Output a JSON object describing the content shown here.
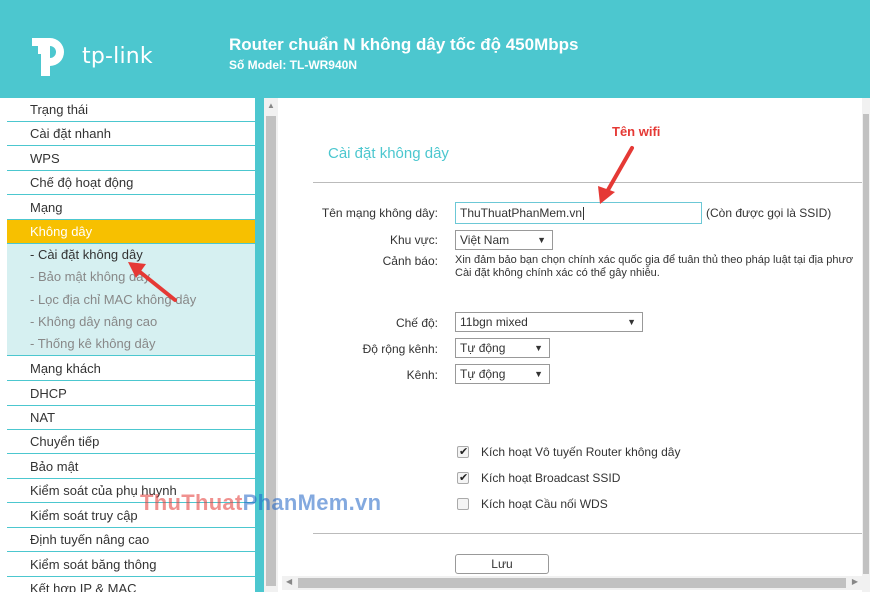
{
  "header": {
    "logo_text": "tp-link",
    "title": "Router chuẩn N không dây tốc độ 450Mbps",
    "model": "Số Model: TL-WR940N",
    "bg_color": "#4cc7cf"
  },
  "sidebar": {
    "items": [
      {
        "label": "Trạng thái"
      },
      {
        "label": "Cài đặt nhanh"
      },
      {
        "label": "WPS"
      },
      {
        "label": "Chế độ hoạt động"
      },
      {
        "label": "Mạng"
      },
      {
        "label": "Không dây"
      },
      {
        "label": "Mạng khách"
      },
      {
        "label": "DHCP"
      },
      {
        "label": "NAT"
      },
      {
        "label": "Chuyển tiếp"
      },
      {
        "label": "Bảo mật"
      },
      {
        "label": "Kiểm soát của phụ huynh"
      },
      {
        "label": "Kiểm soát truy cập"
      },
      {
        "label": "Định tuyến nâng cao"
      },
      {
        "label": "Kiểm soát băng thông"
      },
      {
        "label": "Kết hợp IP & MAC"
      }
    ],
    "subitems": [
      {
        "label": "- Cài đặt không dây"
      },
      {
        "label": "- Bảo mật không dây"
      },
      {
        "label": "- Lọc địa chỉ MAC không dây"
      },
      {
        "label": "- Không dây nâng cao"
      },
      {
        "label": "- Thống kê không dây"
      }
    ],
    "active_color": "#f7c000"
  },
  "main": {
    "section_title": "Cài đặt không dây",
    "ssid_label": "Tên mạng không dây:",
    "ssid_value": "ThuThuatPhanMem.vn",
    "ssid_hint": "(Còn được gọi là SSID)",
    "region_label": "Khu vực:",
    "region_value": "Việt Nam",
    "warning_label": "Cảnh báo:",
    "warning_line1": "Xin đảm bảo bạn chọn chính xác quốc gia để tuân thủ theo pháp luật tại địa phươ",
    "warning_line2": "Cài đặt không chính xác có thể gây nhiễu.",
    "mode_label": "Chế độ:",
    "mode_value": "11bgn mixed",
    "width_label": "Độ rộng kênh:",
    "width_value": "Tự động",
    "channel_label": "Kênh:",
    "channel_value": "Tự động",
    "checkboxes": [
      {
        "label": "Kích hoạt Vô tuyến Router không dây",
        "checked": true
      },
      {
        "label": "Kích hoạt Broadcast SSID",
        "checked": true
      },
      {
        "label": "Kích hoạt Cầu nối WDS",
        "checked": false
      }
    ],
    "save_label": "Lưu"
  },
  "annotations": {
    "wifi_label": "Tên wifi",
    "watermark_part1": "Thu",
    "watermark_part2": "Thuat",
    "watermark_part3": "PhanMem",
    "watermark_part4": ".vn"
  }
}
